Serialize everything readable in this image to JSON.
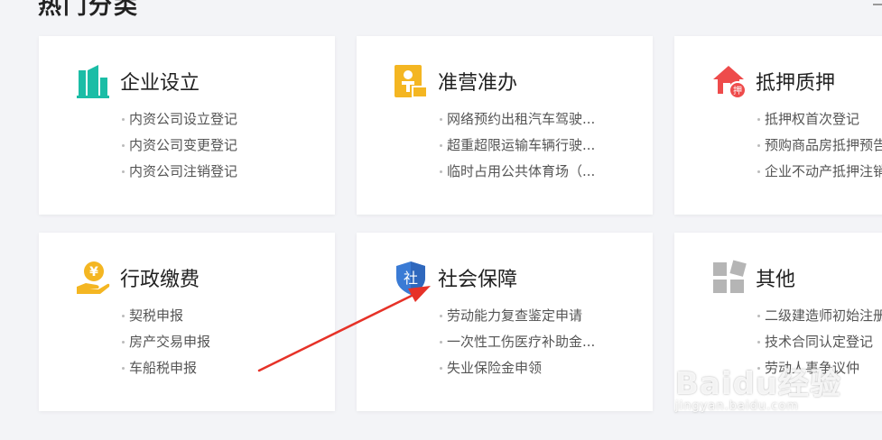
{
  "section": {
    "title": "热门分类"
  },
  "colors": {
    "teal": "#1bbda6",
    "yellow": "#f4b622",
    "red": "#ee4b4b",
    "blue": "#3a7bd5",
    "gray": "#b5b5b5",
    "arrow": "#e63228"
  },
  "cards": [
    {
      "title": "企业设立",
      "icon": "building-icon",
      "items": [
        "内资公司设立登记",
        "内资公司变更登记",
        "内资公司注销登记"
      ]
    },
    {
      "title": "准营准办",
      "icon": "license-icon",
      "items": [
        "网络预约出租汽车驾驶...",
        "超重超限运输车辆行驶...",
        "临时占用公共体育场（..."
      ]
    },
    {
      "title": "抵押质押",
      "icon": "house-mortgage-icon",
      "icon_text": "押",
      "items": [
        "抵押权首次登记",
        "预购商品房抵押预告",
        "企业不动产抵押注销"
      ]
    },
    {
      "title": "行政缴费",
      "icon": "coin-hand-icon",
      "icon_text": "¥",
      "items": [
        "契税申报",
        "房产交易申报",
        "车船税申报"
      ]
    },
    {
      "title": "社会保障",
      "icon": "shield-icon",
      "icon_text": "社",
      "items": [
        "劳动能力复查鉴定申请",
        "一次性工伤医疗补助金...",
        "失业保险金申领"
      ]
    },
    {
      "title": "其他",
      "icon": "grid-icon",
      "items": [
        "二级建造师初始注册",
        "技术合同认定登记",
        "劳动人事争议仲"
      ]
    }
  ],
  "watermark": {
    "main": "Baidu经验",
    "sub": "jingyan.baidu.com"
  }
}
